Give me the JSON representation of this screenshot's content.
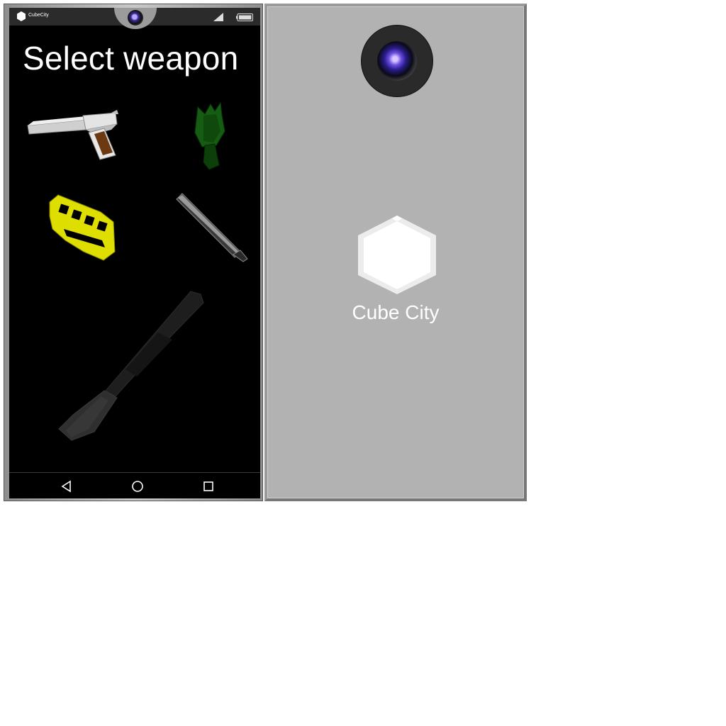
{
  "app": {
    "name_small": "CubeCity"
  },
  "screen": {
    "title": "Select weapon"
  },
  "weapons": [
    {
      "id": "pistol",
      "color": "#d8d8d8"
    },
    {
      "id": "bottle",
      "color": "#1c5a10"
    },
    {
      "id": "brass-knuckles",
      "color": "#e6e600"
    },
    {
      "id": "baseball-bat",
      "color": "#8a8a8a"
    },
    {
      "id": "shotgun",
      "color": "#2a2a2a"
    }
  ],
  "navigation": {
    "buttons": [
      "back",
      "home",
      "recent-apps"
    ]
  },
  "back_panel": {
    "brand_name": "Cube City"
  },
  "colors": {
    "screen_bg": "#000000",
    "device_back": "#b2b2b2",
    "title": "#ffffff"
  }
}
